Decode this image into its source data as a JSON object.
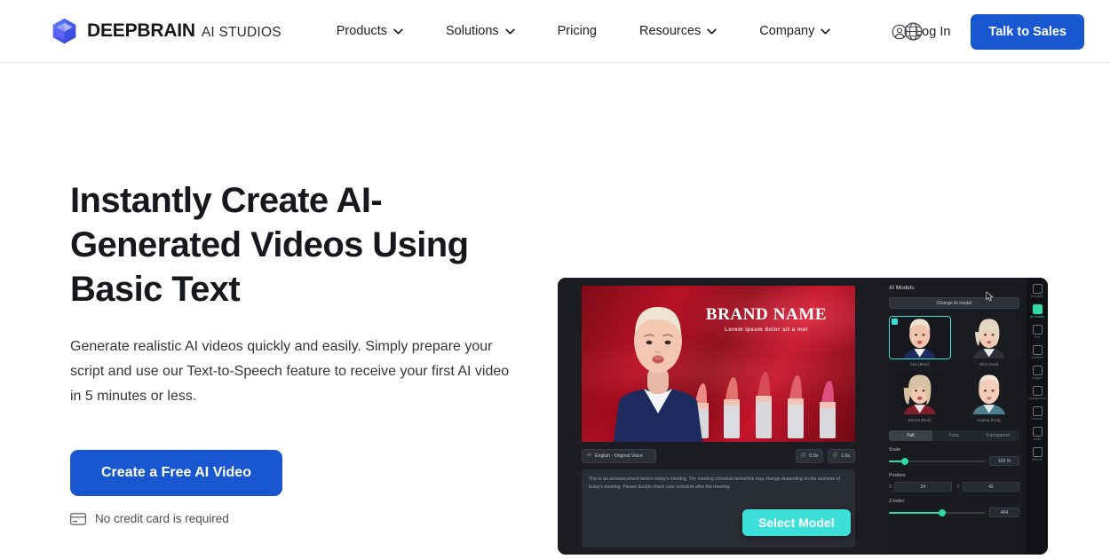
{
  "header": {
    "brand": {
      "name": "DEEPBRAIN",
      "sub": "AI STUDIOS",
      "logo_icon": "cube-logo-icon"
    },
    "nav": [
      {
        "label": "Products",
        "has_chevron": true
      },
      {
        "label": "Solutions",
        "has_chevron": true
      },
      {
        "label": "Pricing",
        "has_chevron": false
      },
      {
        "label": "Resources",
        "has_chevron": true
      },
      {
        "label": "Company",
        "has_chevron": true
      }
    ],
    "language_icon": "globe-icon",
    "login_label": "Log In",
    "login_icon": "user-circle-icon",
    "cta_label": "Talk to Sales"
  },
  "hero": {
    "title": "Instantly Create AI-Generated Videos Using Basic Text",
    "subtitle": "Generate realistic AI videos quickly and easily. Simply prepare your script and use our Text-to-Speech feature to receive your first AI video in 5 minutes or less.",
    "cta_label": "Create a Free AI Video",
    "note": "No credit card is required",
    "note_icon": "credit-card-icon"
  },
  "mockup": {
    "stage": {
      "brand_title": "BRAND NAME",
      "brand_tagline": "Lorem ipsum dolor sit a met"
    },
    "toolbar": {
      "voice_label": "English - Original Voice",
      "voice_icon": "sound-wave-icon",
      "time_start": "0.0s",
      "time_end": "1.0s",
      "clock_icon": "clock-icon"
    },
    "script_text": "This is an announcement before today's meeting. The meeting schedule below/link may change depending on the outcome of today's meeting. Please double-check your schedule after the meeting.",
    "tooltip_label": "Select Model",
    "panel": {
      "title": "AI Models",
      "change_button": "Change AI model",
      "models": [
        {
          "name": "Mia (Blue)",
          "selected": true
        },
        {
          "name": "Alice (Suit)",
          "selected": false
        },
        {
          "name": "Emma (Red)",
          "selected": false
        },
        {
          "name": "Sophia (Knit)",
          "selected": false
        }
      ],
      "tabs": [
        {
          "label": "Full",
          "active": true
        },
        {
          "label": "Face",
          "active": false
        },
        {
          "label": "Transparent",
          "active": false
        }
      ],
      "scale": {
        "label": "Scale",
        "value": "100 %",
        "percent": 16
      },
      "position": {
        "label": "Position",
        "x_axis": "X",
        "x_value": "24",
        "y_axis": "Y",
        "y_value": "42"
      },
      "zindex": {
        "label": "Z-Index",
        "value": "404",
        "percent": 55
      }
    },
    "rail": [
      {
        "label": "Template",
        "active": false
      },
      {
        "label": "AI Models",
        "active": true
      },
      {
        "label": "Text",
        "active": false
      },
      {
        "label": "Subtitles",
        "active": false
      },
      {
        "label": "Images",
        "active": false
      },
      {
        "label": "Background",
        "active": false
      },
      {
        "label": "Frames",
        "active": false
      },
      {
        "label": "Audio",
        "active": false
      },
      {
        "label": "Effects",
        "active": false
      }
    ]
  },
  "colors": {
    "brand_blue": "#1857cf",
    "accent_teal": "#3de0d8",
    "slider_green": "#2fd9a8"
  }
}
